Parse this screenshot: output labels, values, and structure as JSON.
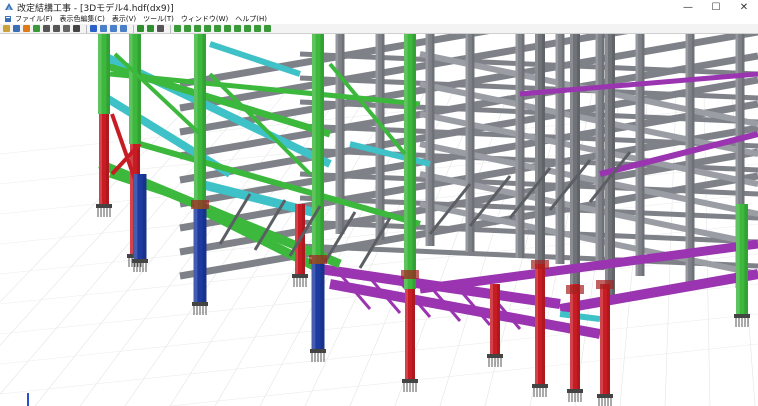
{
  "window": {
    "title": "改定結構工事 - [3Dモデル4.hdf(dx9)]",
    "controls": {
      "minimize": "—",
      "maximize": "☐",
      "close": "✕"
    }
  },
  "menu": [
    {
      "label": "ファイル(F)"
    },
    {
      "label": "表示色編集(C)"
    },
    {
      "label": "表示(V)"
    },
    {
      "label": "ツール(T)"
    },
    {
      "label": "ウィンドウ(W)"
    },
    {
      "label": "ヘルプ(H)"
    }
  ],
  "toolbar": {
    "icons": [
      {
        "name": "open-icon",
        "color": "#c9a23a"
      },
      {
        "name": "save-icon",
        "color": "#3b6fb5"
      },
      {
        "name": "arrow-up-icon",
        "color": "#e07a1a"
      },
      {
        "name": "rotate-icon",
        "color": "#3a9a3a"
      },
      {
        "name": "zoom-icon",
        "color": "#555555"
      },
      {
        "name": "pan-icon",
        "color": "#555555"
      },
      {
        "name": "grid-icon",
        "color": "#666666"
      },
      {
        "name": "fit-icon",
        "color": "#444444"
      },
      {
        "name": "select-icon",
        "color": "#2a62c9"
      },
      {
        "name": "view-front-icon",
        "color": "#4b7fc9"
      },
      {
        "name": "view-side-icon",
        "color": "#4b7fc9"
      },
      {
        "name": "view-top-icon",
        "color": "#4b7fc9"
      },
      {
        "name": "move-icon",
        "color": "#2e8f2e"
      },
      {
        "name": "next-icon",
        "color": "#2e8f2e"
      },
      {
        "name": "cursor-icon",
        "color": "#555555"
      },
      {
        "name": "layer-1-icon",
        "color": "#3a9a3a"
      },
      {
        "name": "layer-2-icon",
        "color": "#3a9a3a"
      },
      {
        "name": "layer-3-icon",
        "color": "#3a9a3a"
      },
      {
        "name": "layer-4-icon",
        "color": "#3a9a3a"
      },
      {
        "name": "layer-5-icon",
        "color": "#3a9a3a"
      },
      {
        "name": "layer-6-icon",
        "color": "#3a9a3a"
      },
      {
        "name": "layer-7-icon",
        "color": "#3a9a3a"
      },
      {
        "name": "layer-8-icon",
        "color": "#3a9a3a"
      },
      {
        "name": "layer-9-icon",
        "color": "#3a9a3a"
      },
      {
        "name": "layer-10-icon",
        "color": "#3a9a3a"
      }
    ]
  },
  "model_colors": {
    "column_red": "#c81c24",
    "column_blue": "#1c3aa0",
    "column_green": "#3cb83c",
    "steel_gray": "#7e8288",
    "beam_cyan": "#3ec2c8",
    "beam_magenta": "#9a34b0"
  },
  "axis_indicator": {
    "name": "xyz-axis-icon",
    "colors": [
      "#2a4fd0",
      "#2aa040",
      "#d03a2a"
    ]
  }
}
